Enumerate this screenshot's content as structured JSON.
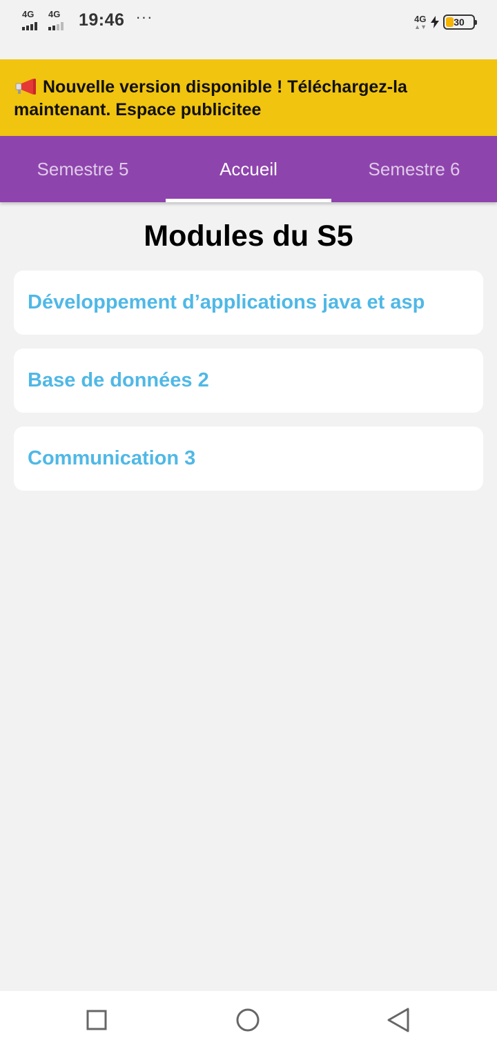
{
  "status_bar": {
    "sim1_label": "4G",
    "sim2_label": "4G",
    "time": "19:46",
    "more_indicator": "···",
    "network_label": "4G",
    "battery_level": "30",
    "battery_fraction": 0.3,
    "battery_color": "#f5b400"
  },
  "banner": {
    "text": "Nouvelle version disponible ! Téléchargez-la maintenant. Espace publicitee",
    "background": "#f1c40f",
    "icon": "megaphone-icon"
  },
  "tabs": [
    {
      "label": "Semestre 5",
      "active": false
    },
    {
      "label": "Accueil",
      "active": true
    },
    {
      "label": "Semestre 6",
      "active": false
    }
  ],
  "tab_bar_color": "#8e44ad",
  "page_title": "Modules du S5",
  "modules": [
    {
      "label": "Développement d’applications java et asp"
    },
    {
      "label": "Base de données 2"
    },
    {
      "label": "Communication 3"
    }
  ],
  "module_text_color": "#4fb8e6",
  "navigation": {
    "recents_icon": "square-icon",
    "home_icon": "circle-icon",
    "back_icon": "triangle-back-icon"
  }
}
